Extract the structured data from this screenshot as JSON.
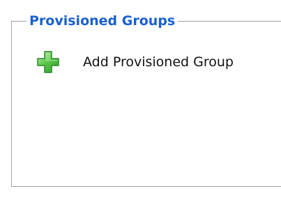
{
  "groupbox": {
    "title": "Provisioned Groups",
    "title_color": "#1a5fd0",
    "border_color": "#a0a0a0"
  },
  "actions": [
    {
      "label": "Add Provisioned Group",
      "icon": "green-plus-icon",
      "icon_color": "#5cc84a"
    }
  ]
}
